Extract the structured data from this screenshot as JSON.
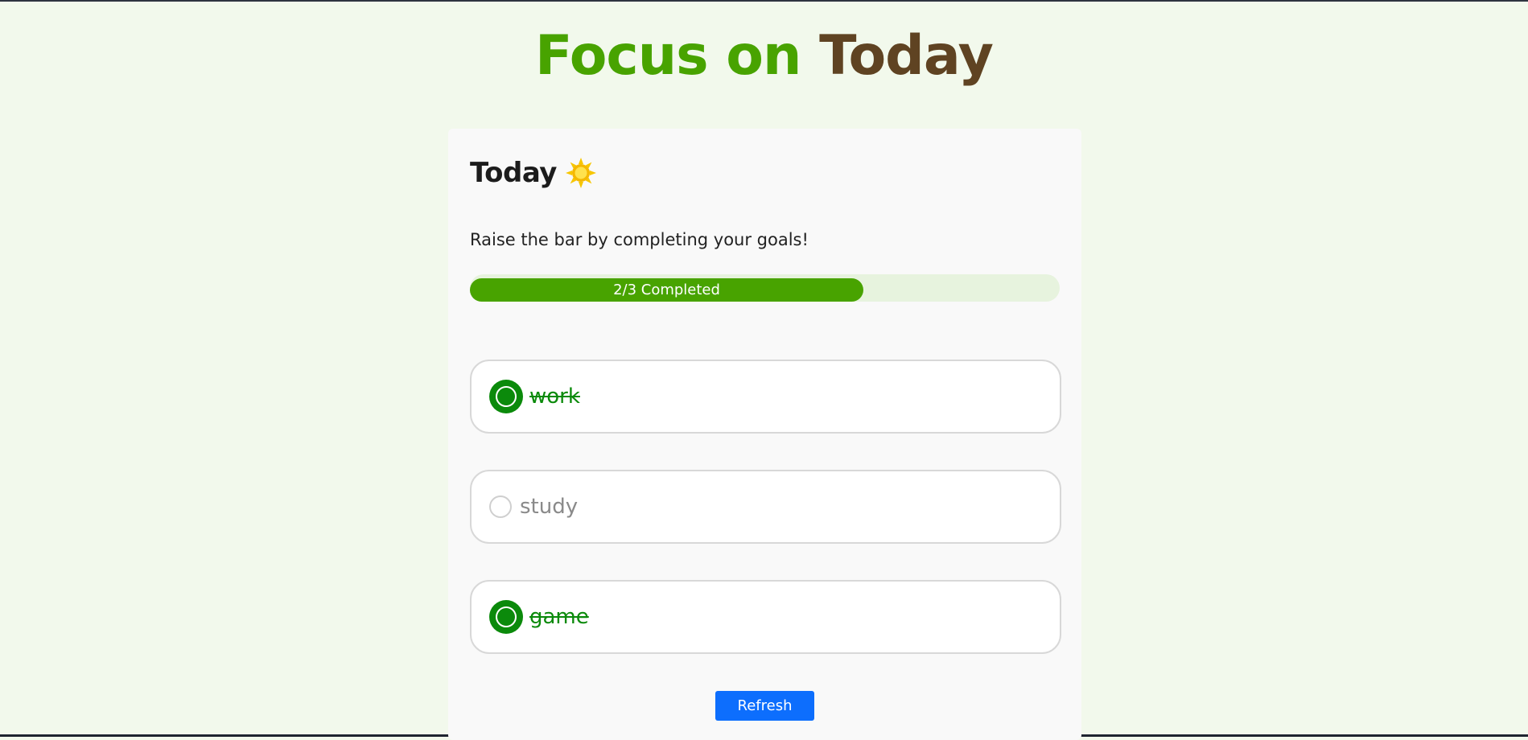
{
  "header": {
    "title_part1": "Focus on",
    "title_part2": "Today"
  },
  "card": {
    "heading": "Today",
    "heading_icon": "sun-icon",
    "subtitle": "Raise the bar by completing your goals!",
    "progress": {
      "label": "2/3 Completed",
      "completed": 2,
      "total": 3,
      "fraction": 0.667
    },
    "goals": [
      {
        "text": "work",
        "completed": true
      },
      {
        "text": "study",
        "completed": false
      },
      {
        "text": "game",
        "completed": true
      }
    ],
    "refresh_label": "Refresh"
  },
  "colors": {
    "brand_green": "#48a300",
    "brand_brown": "#5f4322",
    "completed_green": "#0b8a0b",
    "button_blue": "#0d6efd",
    "background": "#f2f9ec"
  }
}
